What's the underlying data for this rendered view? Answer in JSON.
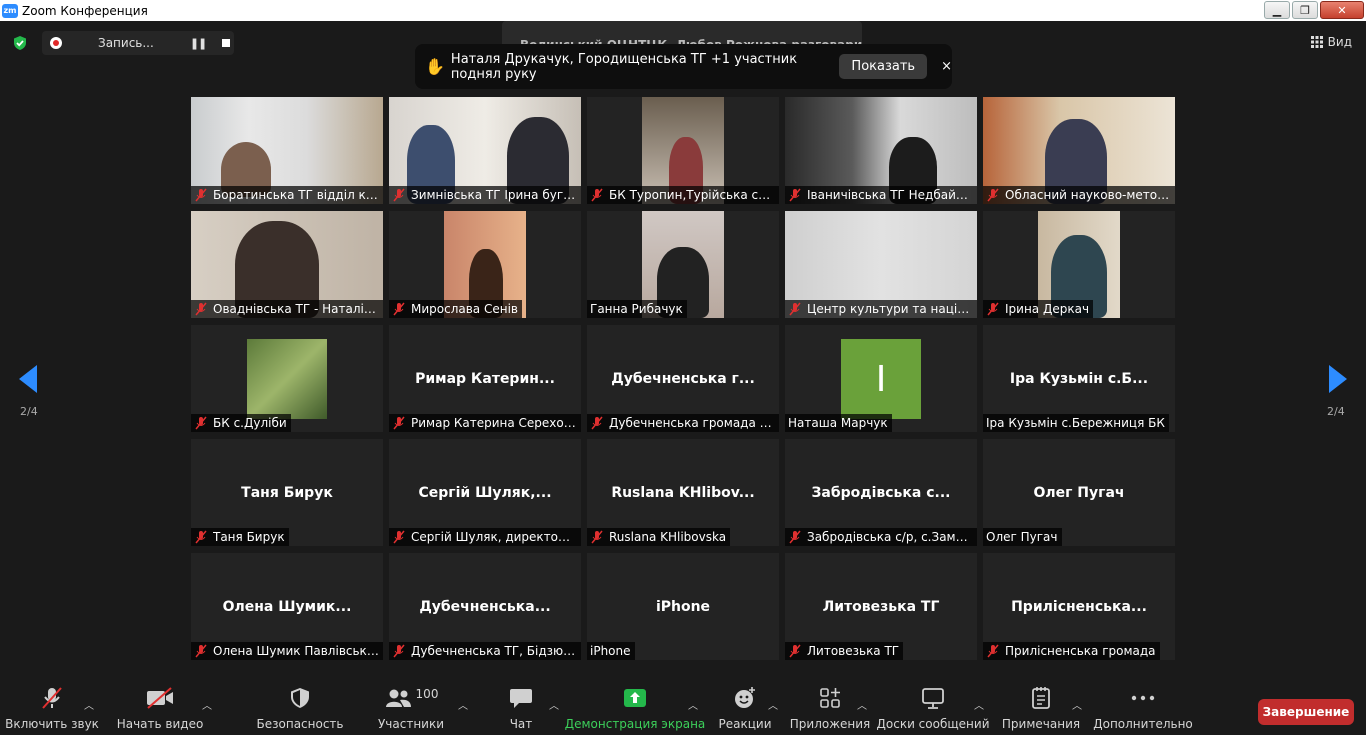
{
  "window": {
    "title": "Zoom Конференция",
    "app_icon": "zm"
  },
  "topbar": {
    "recording_label": "Запись...",
    "view_label": "Вид",
    "speaker_text": "Волинський ОЦНТЦК, Любов Рожнова разговаривает...",
    "hand_notice": "Наталя Друкачук, Городищенська ТГ +1 участник поднял руку",
    "hand_show": "Показать",
    "hand_close": "×"
  },
  "pagination": {
    "prev": "2/4",
    "next": "2/4"
  },
  "tiles": [
    {
      "label": "Боратинська ТГ відділ кул...",
      "big": "",
      "muted": true
    },
    {
      "label": "Зимнівська ТГ Ірина бугай...",
      "big": "",
      "muted": true
    },
    {
      "label": "БК Туропин,Турійська сел...",
      "big": "",
      "muted": true
    },
    {
      "label": "Іваничівська ТГ Недбайло...",
      "big": "",
      "muted": true
    },
    {
      "label": "Обласний науково-метод...",
      "big": "",
      "muted": true
    },
    {
      "label": "Оваднівська ТГ - Наталія ...",
      "big": "",
      "muted": true
    },
    {
      "label": "Мирослава Сенів",
      "big": "",
      "muted": true
    },
    {
      "label": "Ганна Рибачук",
      "big": "",
      "muted": false
    },
    {
      "label": "Центр культури та націон...",
      "big": "",
      "muted": true
    },
    {
      "label": "Ірина Деркач",
      "big": "",
      "muted": true
    },
    {
      "label": "БК с.Дуліби",
      "big": "",
      "muted": true
    },
    {
      "label": "Римар Катерина Серехов...",
      "big": "Римар  Катерин...",
      "muted": true
    },
    {
      "label": "Дубечненська громада БК...",
      "big": "Дубечненська  г...",
      "muted": true
    },
    {
      "label": "Наташа Марчук",
      "big": "",
      "muted": false,
      "initial": "I"
    },
    {
      "label": "Іра Кузьмін с.Бережниця БК",
      "big": "Іра  Кузьмін  с.Б...",
      "muted": false
    },
    {
      "label": "Таня Бирук",
      "big": "Таня Бирук",
      "muted": true
    },
    {
      "label": "Сергій Шуляк, директор к...",
      "big": "Сергій  Шуляк,...",
      "muted": true
    },
    {
      "label": "Ruslana KHlibovska",
      "big": "Ruslana  KHlibov...",
      "muted": true
    },
    {
      "label": "Забродівська с/р, с.Замш...",
      "big": "Забродівська  с...",
      "muted": true
    },
    {
      "label": "Олег Пугач",
      "big": "Олег Пугач",
      "muted": false
    },
    {
      "label": "Олена Шумик Павлівська ...",
      "big": "Олена  Шумик...",
      "muted": true
    },
    {
      "label": "Дубечненська ТГ, Бідзюра...",
      "big": "Дубечненська...",
      "muted": true
    },
    {
      "label": "iPhone",
      "big": "iPhone",
      "muted": false
    },
    {
      "label": "Литовезька ТГ",
      "big": "Литовезька ТГ",
      "muted": true
    },
    {
      "label": "Прилісненська громада",
      "big": "Прилісненська...",
      "muted": true
    }
  ],
  "toolbar": {
    "audio": "Включить звук",
    "video": "Начать видео",
    "security": "Безопасность",
    "participants": "Участники",
    "participants_count": "100",
    "chat": "Чат",
    "share": "Демонстрация экрана",
    "reactions": "Реакции",
    "apps": "Приложения",
    "whiteboards": "Доски сообщений",
    "notes": "Примечания",
    "more": "Дополнительно",
    "end": "Завершение"
  },
  "colors": {
    "share_green": "#3ccf5a",
    "end_red": "#c12d2d",
    "mute_red": "#e03030",
    "arrow_blue": "#2d8cff"
  }
}
